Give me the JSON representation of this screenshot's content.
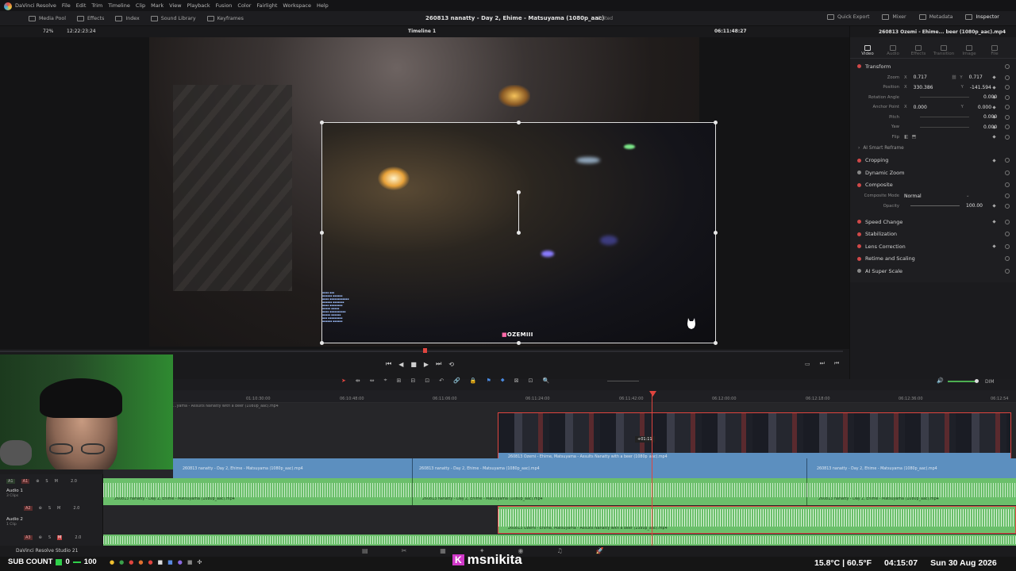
{
  "menubar": {
    "app_name": "DaVinci Resolve",
    "items": [
      "File",
      "Edit",
      "Trim",
      "Timeline",
      "Clip",
      "Mark",
      "View",
      "Playback",
      "Fusion",
      "Color",
      "Fairlight",
      "Workspace",
      "Help"
    ]
  },
  "toolbar": {
    "left": [
      "Media Pool",
      "Effects",
      "Index",
      "Sound Library",
      "Keyframes"
    ],
    "project_title": "260813  nanatty - Day 2, Ehime - Matsuyama (1080p_aac)",
    "edited_status": "Edited",
    "right": [
      "Quick Export",
      "Mixer",
      "Metadata",
      "Inspector"
    ]
  },
  "viewer": {
    "zoom": "72%",
    "source_timecode": "12:22:23:24",
    "timeline_name": "Timeline 1",
    "record_timecode": "06:11:48:27",
    "overlay_logo_text": "OZEMIII"
  },
  "inspector": {
    "clip_name": "260813 Ozemi - Ehime... beer (1080p_aac).mp4",
    "tabs": [
      "Video",
      "Audio",
      "Effects",
      "Transition",
      "Image",
      "File"
    ],
    "transform_title": "Transform",
    "params": [
      {
        "label": "Zoom",
        "x_label": "X",
        "x": "0.717",
        "y_label": "Y",
        "y": "0.717"
      },
      {
        "label": "Position",
        "x_label": "X",
        "x": "330.386",
        "y_label": "Y",
        "y": "-141.594"
      },
      {
        "label": "Rotation Angle",
        "value": "0.000"
      },
      {
        "label": "Anchor Point",
        "x_label": "X",
        "x": "0.000",
        "y_label": "Y",
        "y": "0.000"
      },
      {
        "label": "Pitch",
        "value": "0.000"
      },
      {
        "label": "Yaw",
        "value": "0.000"
      },
      {
        "label": "Flip",
        "value": ""
      }
    ],
    "smart_reframe": "AI Smart Reframe",
    "sections_a": [
      "Cropping",
      "Dynamic Zoom",
      "Composite"
    ],
    "composite_mode_label": "Composite Mode",
    "composite_mode_value": "Normal",
    "opacity_label": "Opacity",
    "opacity_value": "100.00",
    "sections_b": [
      "Speed Change",
      "Stabilization",
      "Lens Correction",
      "Retime and Scaling",
      "AI Super Scale"
    ]
  },
  "timeline": {
    "ruler_ticks": [
      "01:10:30:00",
      "06:10:48:00",
      "06:11:06:00",
      "06:11:24:00",
      "06:11:42:00",
      "06:12:00:00",
      "06:12:18:00",
      "06:12:36:00",
      "06:12:54"
    ],
    "top_track_label": "...yama - Assults Nanatty with a beer (1080p_aac).mp4",
    "v2_clip": "260813  Ozemi - Ehime, Matsuyama - Assults Nanatty with a beer (1080p_aac).mp4",
    "v1_clips": [
      "260813  nanatty - Day 2, Ehime - Matsuyama (1080p_aac).mp4",
      "260813  nanatty - Day 2, Ehime - Matsuyama (1080p_aac).mp4",
      "260813  nanatty - Day 2, Ehime - Matsuyama (1080p_aac).mp4"
    ],
    "a1_clips": [
      "260813  nanatty - Day 2, Ehime - Matsuyama (1080p_aac).mp4",
      "260813  nanatty - Day 2, Ehime - Matsuyama (1080p_aac).mp4",
      "260813  nanatty - Day 2, Ehime - Matsuyama (1080p_aac).mp4"
    ],
    "a2_clip": "260813  Ozemi - Ehime, Matsuyama - Assults Nanatty with a beer (1080p_aac).mp4",
    "trim_tooltip": "+01:11",
    "tracks": [
      {
        "id": "A1",
        "name": "Audio 1",
        "clips": "3 Clips",
        "level": "2.0"
      },
      {
        "id": "A2",
        "name": "Audio 2",
        "clips": "1 Clip",
        "level": "2.0"
      },
      {
        "id": "A3",
        "name": "",
        "clips": "",
        "level": "2.0"
      }
    ],
    "dim_label": "DIM"
  },
  "status": {
    "product": "DaVinci Resolve Studio 21"
  },
  "overlay": {
    "sub_count_label": "SUB COUNT",
    "sub_count_value": "0",
    "sub_count_goal": "100",
    "channel_name": "msnikita",
    "weather": "15.8°C | 60.5°F",
    "time": "04:15:07",
    "date": "Sun 30 Aug 2026"
  },
  "colors": {
    "audio_green": "#6bbf6b",
    "video_blue": "#5c8fbf",
    "playhead_red": "#e0453f"
  }
}
